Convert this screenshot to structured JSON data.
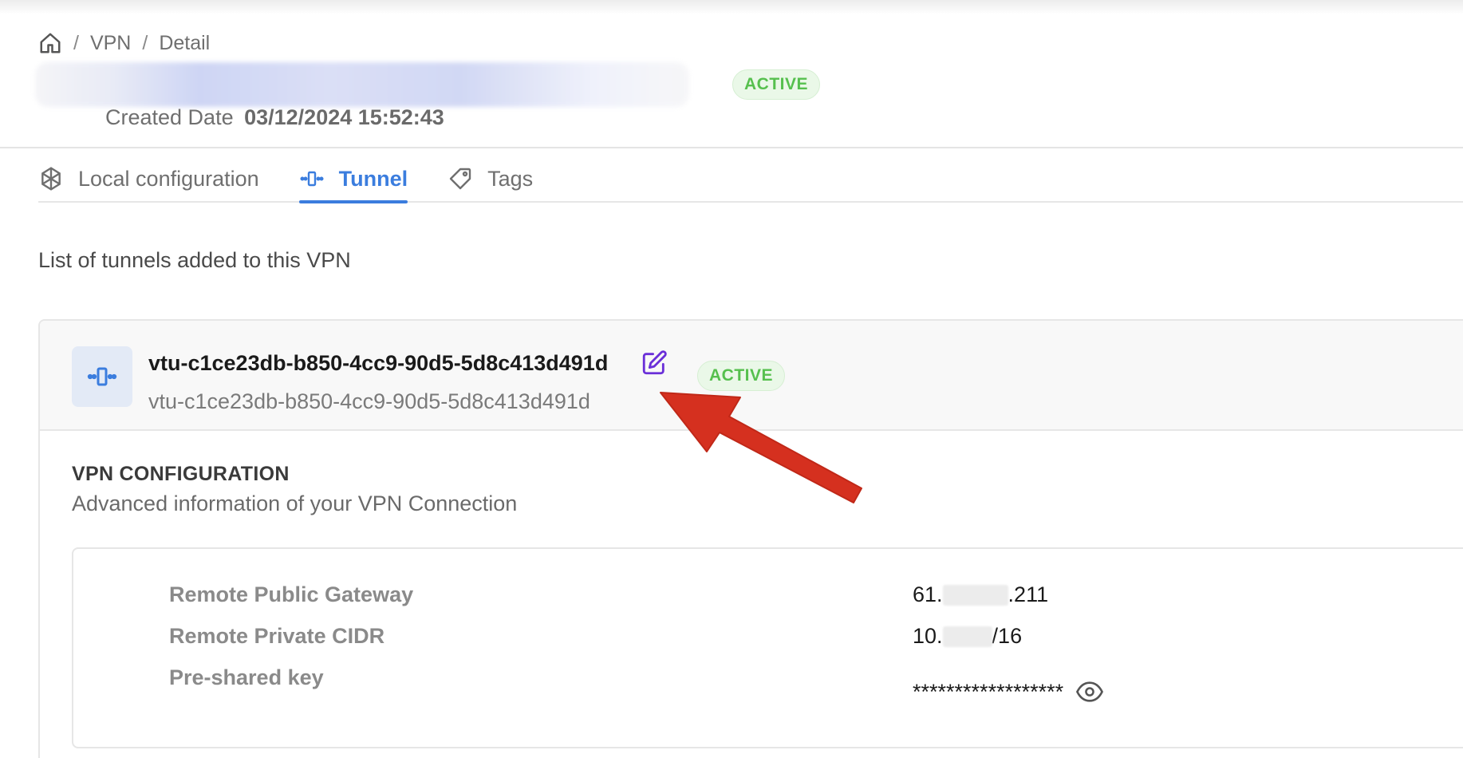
{
  "breadcrumb": {
    "items": [
      "VPN",
      "Detail"
    ],
    "separator": "/"
  },
  "header": {
    "status": "ACTIVE",
    "created_label": "Created Date",
    "created_value": "03/12/2024 15:52:43"
  },
  "tabs": [
    {
      "label": "Local configuration",
      "icon": "network-icon",
      "active": false
    },
    {
      "label": "Tunnel",
      "icon": "tunnel-icon",
      "active": true
    },
    {
      "label": "Tags",
      "icon": "tag-icon",
      "active": false
    }
  ],
  "section_intro": "List of tunnels added to this VPN",
  "tunnel": {
    "name": "vtu-c1ce23db-b850-4cc9-90d5-5d8c413d491d",
    "subtitle": "vtu-c1ce23db-b850-4cc9-90d5-5d8c413d491d",
    "status": "ACTIVE"
  },
  "vpn_config": {
    "title": "VPN CONFIGURATION",
    "description": "Advanced information of your VPN Connection",
    "rows": [
      {
        "label": "Remote Public Gateway",
        "prefix": "61.",
        "suffix": ".211"
      },
      {
        "label": "Remote Private CIDR",
        "prefix": "10.",
        "suffix": "/16"
      },
      {
        "label": "Pre-shared key",
        "prefix": "******************",
        "suffix": ""
      }
    ]
  },
  "colors": {
    "accent": "#3b7dde",
    "active_bg": "#eaf8e8",
    "active_text": "#56c04e",
    "edit_icon": "#6a2fd8",
    "arrow": "#d5301f"
  }
}
